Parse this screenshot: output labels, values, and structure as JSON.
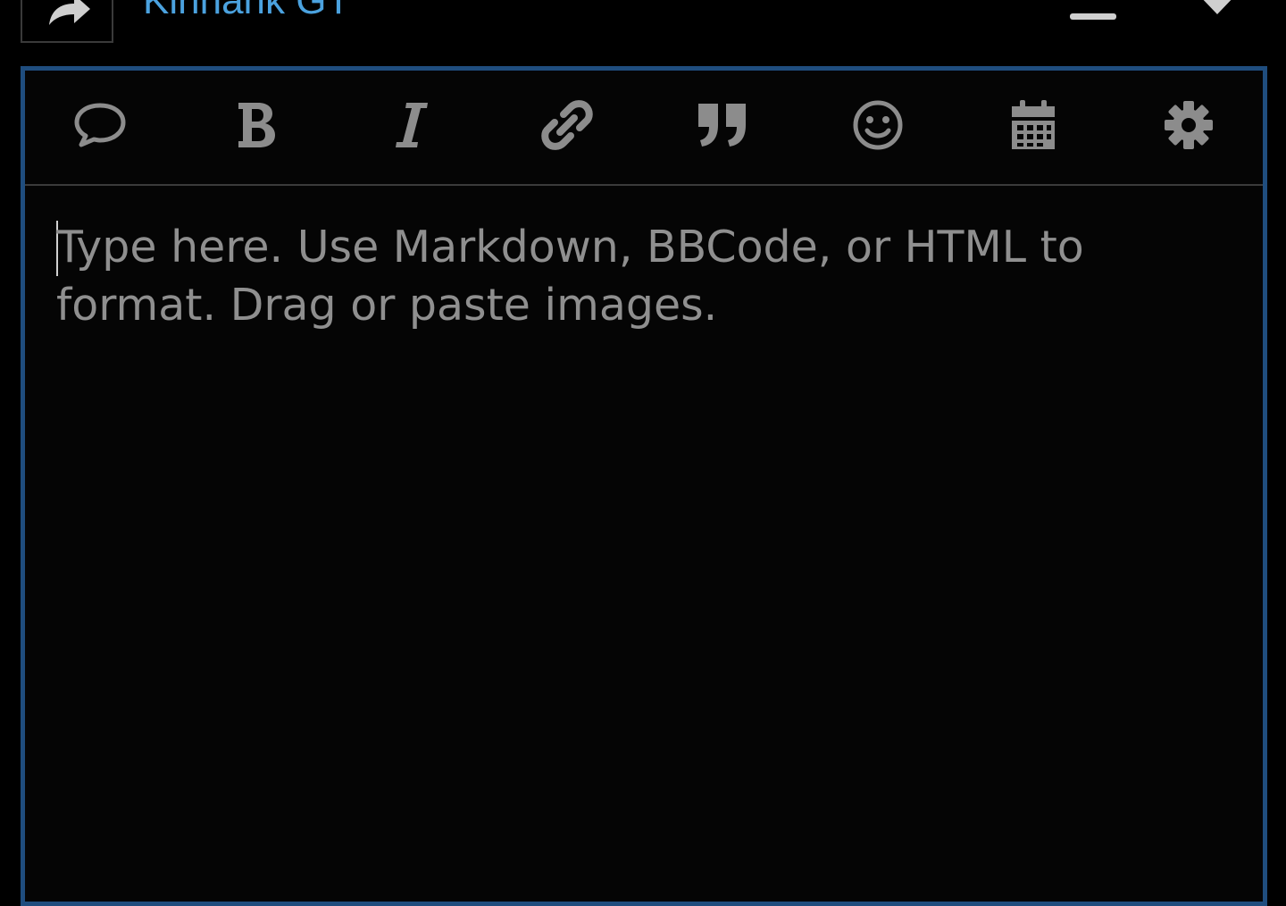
{
  "header": {
    "topic_title": "Kinhank GT",
    "reply_icon": "reply-arrow-icon",
    "menu_icon": "hamburger-menu-icon",
    "notification_icon": "bell-icon"
  },
  "editor": {
    "toolbar": [
      {
        "name": "comment",
        "icon": "speech-bubble-icon"
      },
      {
        "name": "bold",
        "icon": "bold-icon"
      },
      {
        "name": "italic",
        "icon": "italic-icon"
      },
      {
        "name": "link",
        "icon": "link-icon"
      },
      {
        "name": "quote",
        "icon": "quote-icon"
      },
      {
        "name": "emoji",
        "icon": "smiley-icon"
      },
      {
        "name": "date",
        "icon": "calendar-icon"
      },
      {
        "name": "options",
        "icon": "gear-icon"
      }
    ],
    "placeholder": "Type here. Use Markdown, BBCode, or HTML to format. Drag or paste images."
  },
  "colors": {
    "background": "#000000",
    "accent_blue": "#4ba2df",
    "editor_border": "#1f4d7e",
    "icon_gray": "#8c8c8c",
    "placeholder_gray": "#8f8f8f"
  }
}
